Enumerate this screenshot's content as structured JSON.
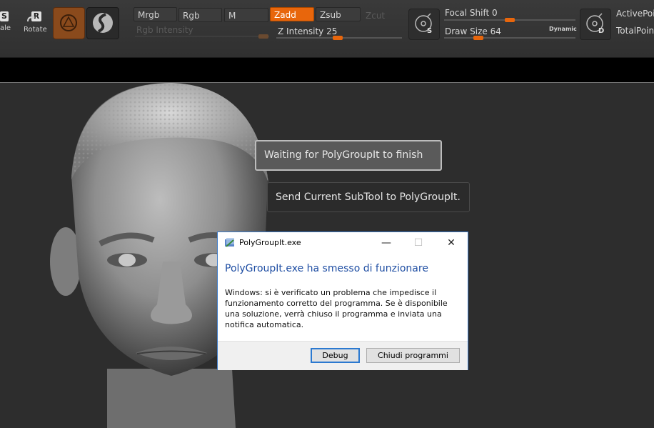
{
  "toolbar": {
    "scale_label": "ale",
    "scale_key": "S",
    "rotate_label": "Rotate",
    "rotate_key": "R",
    "modes": {
      "mrgb": "Mrgb",
      "rgb": "Rgb",
      "m": "M",
      "zadd": "Zadd",
      "zsub": "Zsub",
      "zcut": "Zcut"
    },
    "rgb_intensity": {
      "label": "Rgb Intensity"
    },
    "z_intensity": {
      "label": "Z Intensity",
      "value": "25"
    },
    "focal_shift": {
      "label": "Focal Shift",
      "value": "0"
    },
    "draw_size": {
      "label": "Draw Size",
      "value": "64"
    },
    "dynamic_label": "Dynamic",
    "icon_s_letter": "S",
    "icon_d_letter": "D",
    "active_points": "ActivePoin",
    "total_points": "TotalPoin",
    "accent_color": "#e8660c"
  },
  "popup": {
    "waiting": "Waiting for PolyGroupIt to finish",
    "send": "Send Current SubTool to PolyGroupIt."
  },
  "dialog": {
    "title": "PolyGroupIt.exe",
    "heading": "PolyGroupIt.exe ha smesso di funzionare",
    "body": "Windows: si è verificato un problema che impedisce il funzionamento corretto del programma. Se è disponibile una soluzione, verrà chiuso il programma e inviata una notifica automatica.",
    "debug_button": "Debug",
    "close_button": "Chiudi programmi",
    "minimize": "—",
    "maximize": "☐",
    "close": "✕"
  }
}
